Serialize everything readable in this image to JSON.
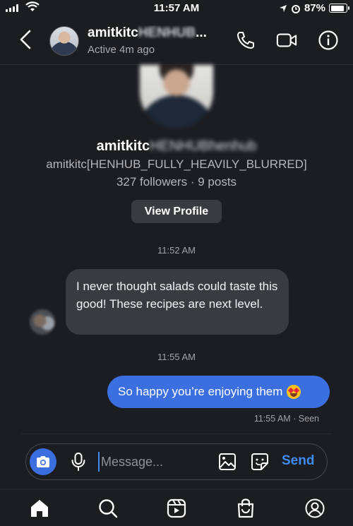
{
  "status_bar": {
    "time": "11:57 AM",
    "battery_percent": "87%",
    "battery_level": 0.87
  },
  "header": {
    "name_visible": "amitkitc",
    "name_blurred": "HENHUB",
    "name_ellipsis": "...",
    "status": "Active 4m ago"
  },
  "profile": {
    "name_visible": "amitkitc",
    "name_blurred": "HENHUBhenhub",
    "handle": "amitkitc[HENHUB_FULLY_HEAVILY_BLURRED]",
    "stats": "327 followers · 9 posts",
    "view_profile_label": "View Profile"
  },
  "messages": [
    {
      "timestamp": "11:52 AM",
      "direction": "incoming",
      "text": "I never thought salads could taste this good! These recipes are next level."
    },
    {
      "timestamp": "11:55 AM",
      "direction": "outgoing",
      "text": "So happy you’re enjoying them",
      "emoji": "heart-eyes-emoji"
    }
  ],
  "read_receipt": "11:55 AM · Seen",
  "composer": {
    "placeholder": "Message...",
    "send_label": "Send"
  },
  "colors": {
    "background": "#1c1d21",
    "incoming_bubble": "#3a3b40",
    "outgoing_bubble": "#3b6fe0",
    "accent": "#3f8bf6"
  },
  "nav": {
    "items": [
      "home-icon",
      "search-icon",
      "reels-icon",
      "shop-icon",
      "profile-icon"
    ]
  }
}
